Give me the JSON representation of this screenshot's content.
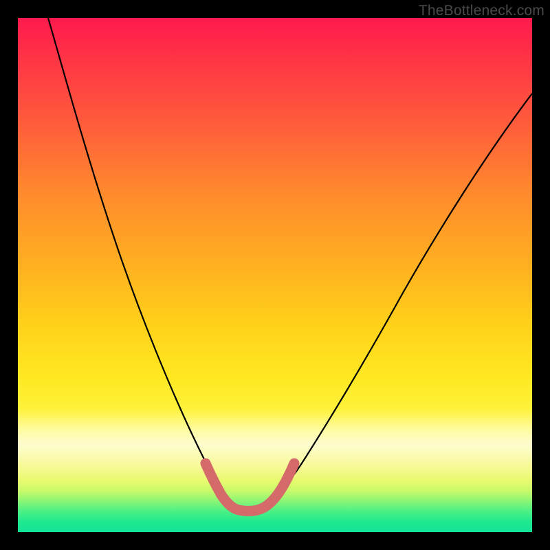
{
  "watermark": "TheBottleneck.com",
  "chart_data": {
    "type": "line",
    "title": "",
    "xlabel": "",
    "ylabel": "",
    "xlim": [
      0,
      100
    ],
    "ylim": [
      0,
      100
    ],
    "series": [
      {
        "name": "bottleneck-curve",
        "x": [
          5,
          10,
          15,
          20,
          25,
          30,
          35,
          38,
          40,
          42,
          44,
          46,
          48,
          50,
          55,
          60,
          65,
          70,
          75,
          80,
          85,
          90,
          95,
          100
        ],
        "values": [
          100,
          88,
          76,
          64,
          52,
          40,
          28,
          18,
          10,
          5,
          3,
          2.5,
          3,
          5,
          12,
          20,
          28,
          35,
          42,
          48,
          54,
          59,
          64,
          68
        ]
      }
    ],
    "highlight": {
      "name": "optimal-range",
      "x": [
        38,
        40,
        42,
        44,
        46,
        48,
        50
      ],
      "values": [
        11,
        6,
        3.5,
        2.8,
        3.2,
        5,
        8
      ],
      "color": "#d46a6a"
    }
  }
}
